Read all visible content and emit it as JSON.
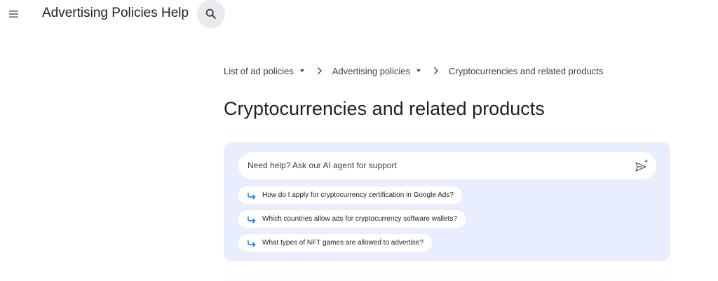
{
  "header": {
    "title": "Advertising Policies Help",
    "menu_icon": "hamburger-menu-icon",
    "search_icon": "search-icon"
  },
  "breadcrumb": {
    "items": [
      {
        "label": "List of ad policies",
        "has_dropdown": true
      },
      {
        "label": "Advertising policies",
        "has_dropdown": true
      },
      {
        "label": "Cryptocurrencies and related products",
        "has_dropdown": false
      }
    ]
  },
  "page": {
    "title": "Cryptocurrencies and related products"
  },
  "ai_panel": {
    "placeholder": "Need help? Ask our AI agent for support",
    "suggestions": [
      "How do I apply for cryptocurrency certification in Google Ads?",
      "Which countries allow ads for cryptocurrency software wallets?",
      "What types of NFT games are allowed to advertise?"
    ]
  },
  "colors": {
    "panel_background": "#e8eefe",
    "accent_blue": "#1a73e8",
    "search_button_bg": "#e8eaed"
  }
}
